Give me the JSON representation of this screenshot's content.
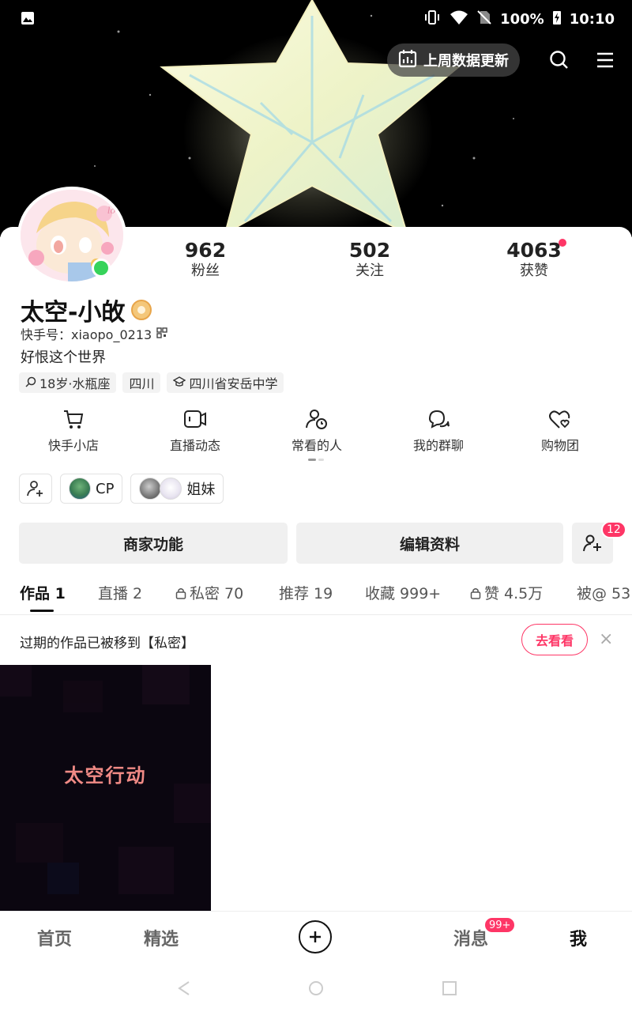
{
  "status_bar": {
    "battery": "100%",
    "time": "10:10"
  },
  "top_bar": {
    "update_label": "上周数据更新"
  },
  "stats": [
    {
      "value": "962",
      "label": "粉丝"
    },
    {
      "value": "502",
      "label": "关注"
    },
    {
      "value": "4063",
      "label": "获赞"
    }
  ],
  "profile": {
    "name": "太空-小敀",
    "kuaishou_id": "快手号：xiaopo_0213",
    "bio": "好恨这个世界",
    "tags": [
      "18岁·水瓶座",
      "四川",
      "四川省安岳中学"
    ]
  },
  "shortcuts": [
    "快手小店",
    "直播动态",
    "常看的人",
    "我的群聊",
    "购物团"
  ],
  "relations": [
    {
      "label": "CP"
    },
    {
      "label": "姐妹"
    }
  ],
  "actions": {
    "merchant": "商家功能",
    "edit_profile": "编辑资料",
    "add_friend_badge": "12"
  },
  "tabs": [
    {
      "label": "作品 1",
      "locked": false
    },
    {
      "label": "直播 2",
      "locked": false
    },
    {
      "label": "私密 70",
      "locked": true
    },
    {
      "label": "推荐 19",
      "locked": false
    },
    {
      "label": "收藏 999+",
      "locked": false
    },
    {
      "label": "赞 4.5万",
      "locked": true
    },
    {
      "label": "被@ 53",
      "locked": false
    }
  ],
  "notice": {
    "text": "过期的作品已被移到【私密】",
    "button": "去看看",
    "close": "×"
  },
  "video": {
    "title": "太空行动"
  },
  "bottom_nav": {
    "home": "首页",
    "featured": "精选",
    "messages": "消息",
    "messages_badge": "99+",
    "me": "我"
  },
  "colors": {
    "accent": "#fe3666",
    "online": "#36d35a"
  }
}
